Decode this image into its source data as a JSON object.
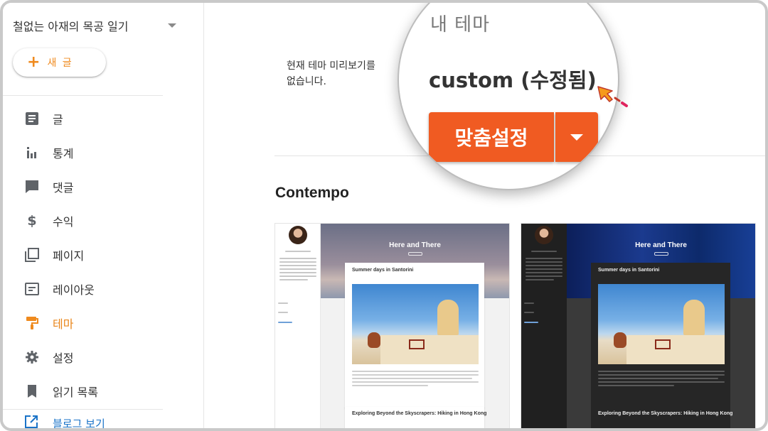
{
  "sidebar": {
    "blog_title": "철없는 아재의 목공 일기",
    "new_post_icon": "plus-icon",
    "new_post_label": "새 글",
    "items": [
      {
        "label": "글",
        "icon": "post-icon"
      },
      {
        "label": "통계",
        "icon": "stats-icon"
      },
      {
        "label": "댓글",
        "icon": "comment-icon"
      },
      {
        "label": "수익",
        "icon": "dollar-icon"
      },
      {
        "label": "페이지",
        "icon": "pages-icon"
      },
      {
        "label": "레이아웃",
        "icon": "layout-icon"
      },
      {
        "label": "테마",
        "icon": "paint-roller-icon",
        "active": true
      },
      {
        "label": "설정",
        "icon": "gear-icon"
      },
      {
        "label": "읽기 목록",
        "icon": "bookmark-icon"
      }
    ],
    "view_blog_label": "블로그 보기",
    "view_blog_icon": "external-link-icon"
  },
  "main": {
    "preview_text_1": "현재 테마 미리보기를 ",
    "preview_text_2": "없습니다.",
    "section_title": "Contempo",
    "theme_cards": [
      {
        "variant": "light",
        "hero_title": "Here and There",
        "post_title": "Summer days in Santorini",
        "post2_title": "Exploring Beyond the Skyscrapers: Hiking in Hong Kong"
      },
      {
        "variant": "dark",
        "hero_title": "Here and There",
        "post_title": "Summer days in Santorini",
        "post2_title": "Exploring Beyond the Skyscrapers: Hiking in Hong Kong"
      }
    ]
  },
  "magnifier": {
    "label": "내 테마",
    "theme_name": "custom (수정됨)",
    "customize_button": "맞춤설정",
    "dropdown_icon": "caret-down-icon"
  },
  "colors": {
    "accent": "#ef8a1e",
    "button": "#f05b22",
    "link": "#1a73c8"
  }
}
